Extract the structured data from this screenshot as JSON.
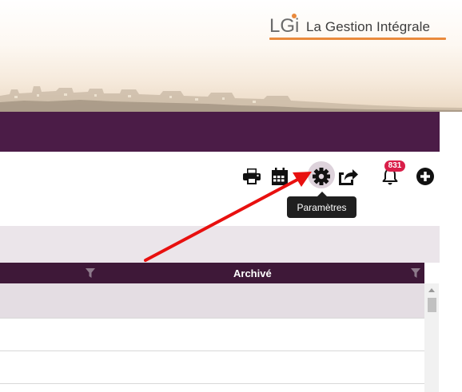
{
  "brand": {
    "logo_mark": "LGi",
    "logo_text": "La Gestion Intégrale",
    "accent_color": "#e98a3c"
  },
  "header": {
    "bar_color": "#4b1c47"
  },
  "toolbar": {
    "icons": [
      "print-icon",
      "calendar-icon",
      "gear-icon",
      "share-icon",
      "bell-icon",
      "add-icon"
    ],
    "notifications_count": "831",
    "tooltip": "Paramètres"
  },
  "table": {
    "columns": [
      "",
      "Archivé"
    ],
    "header_color": "#3e1838"
  },
  "annotation": {
    "arrow_color": "#e8100f",
    "points_to": "gear-icon"
  }
}
